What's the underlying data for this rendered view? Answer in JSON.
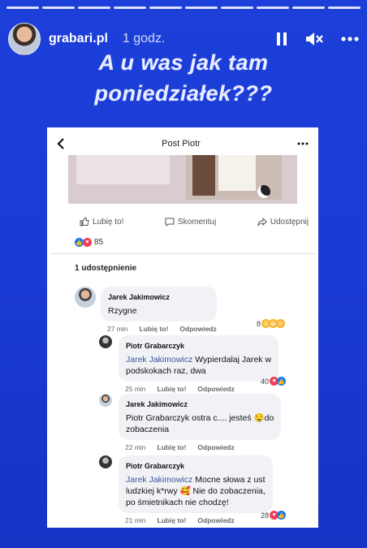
{
  "story": {
    "segments": 10,
    "username": "grabari.pl",
    "time": "1 godz.",
    "caption_line1": "A u was jak tam",
    "caption_line2": "poniedziałek???"
  },
  "post": {
    "title": "Post Piotr",
    "like_label": "Lubię to!",
    "comment_label": "Skomentuj",
    "share_label": "Udostępnij",
    "reaction_count": "85",
    "shares_text": "1 udostępnienie"
  },
  "comments": [
    {
      "author": "Jarek Jakimowicz",
      "text": "Rzygne",
      "time": "27 min",
      "like": "Lubię to!",
      "reply": "Odpowiedz",
      "reactions": "8"
    },
    {
      "author": "Piotr Grabarczyk",
      "mention": "Jarek Jakimowicz",
      "text_a": " Wypierdalaj Jarek w",
      "text_b": "podskokach raz, dwa",
      "time": "25 min",
      "like": "Lubię to!",
      "reply": "Odpowiedz",
      "reactions": "40"
    },
    {
      "author": "Jarek Jakimowicz",
      "text_a": "Piotr Grabarczyk ostra c.... jesteś 🤤do",
      "text_b": "zobaczenia",
      "time": "22 min",
      "like": "Lubię to!",
      "reply": "Odpowiedz"
    },
    {
      "author": "Piotr Grabarczyk",
      "mention": "Jarek Jakimowicz",
      "text_a": " Mocne słowa z ust",
      "text_b": "ludzkiej k*rwy 🥰 Nie do zobaczenia,",
      "text_c": "po śmietnikach nie chodzę!",
      "time": "21 min",
      "like": "Lubię to!",
      "reply": "Odpowiedz",
      "reactions": "28"
    }
  ],
  "colors": {
    "background": "#1d3fd9",
    "mention": "#385898",
    "like_blue": "#1877f2",
    "love_red": "#f33e58",
    "haha_yellow": "#f7b125"
  }
}
